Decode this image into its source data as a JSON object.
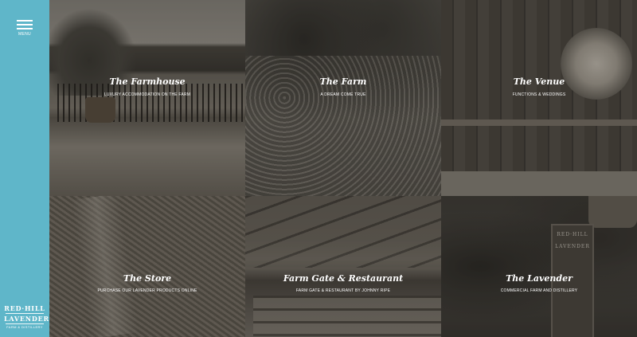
{
  "sidebar": {
    "menu_label": "MENU",
    "logo": {
      "line1": "RED·HILL",
      "line2": "LAVENDER",
      "line3": "FARM & DISTILLERY"
    },
    "background_color": "#5fb6c9"
  },
  "tiles": [
    {
      "title": "The Farmhouse",
      "subtitle": "LUXURY ACCOMMODATION ON THE FARM"
    },
    {
      "title": "The Farm",
      "subtitle": "A DREAM COME TRUE"
    },
    {
      "title": "The Venue",
      "subtitle": "FUNCTIONS & WEDDINGS"
    },
    {
      "title": "The Store",
      "subtitle": "PURCHASE OUR LAVENDER PRODUCTS ONLINE"
    },
    {
      "title": "Farm Gate & Restaurant",
      "subtitle": "FARM GATE & RESTAURANT BY JOHNNY RIPE"
    },
    {
      "title": "The Lavender",
      "subtitle": "COMMERCIAL FARM AND DISTILLERY"
    }
  ],
  "signage": {
    "line1": "RED·HILL",
    "line2": "LAVENDER"
  }
}
